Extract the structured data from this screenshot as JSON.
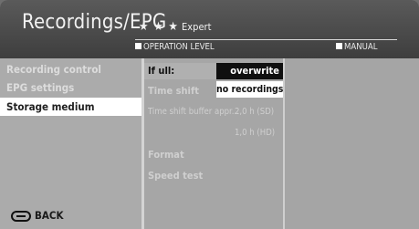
{
  "header": {
    "title": "Recordings/EPG",
    "stars": "★ ★ ★",
    "level": "Expert",
    "operation_level": "OPERATION LEVEL",
    "manual": "MANUAL"
  },
  "menu": {
    "items": [
      {
        "label": "Recording control"
      },
      {
        "label": "EPG settings"
      },
      {
        "label": "Storage medium"
      }
    ]
  },
  "settings": {
    "if_full_label": "If ull:",
    "if_full_value": "overwrite",
    "if_full_option2": "no recordings",
    "time_shift": "Time shift",
    "buffer_label": "Time shift buffer appr...",
    "buffer_sd": "2,0 h (SD)",
    "buffer_hd": "1,0 h (HD)",
    "format": "Format",
    "speed_test": "Speed test"
  },
  "footer": {
    "back": "BACK"
  }
}
